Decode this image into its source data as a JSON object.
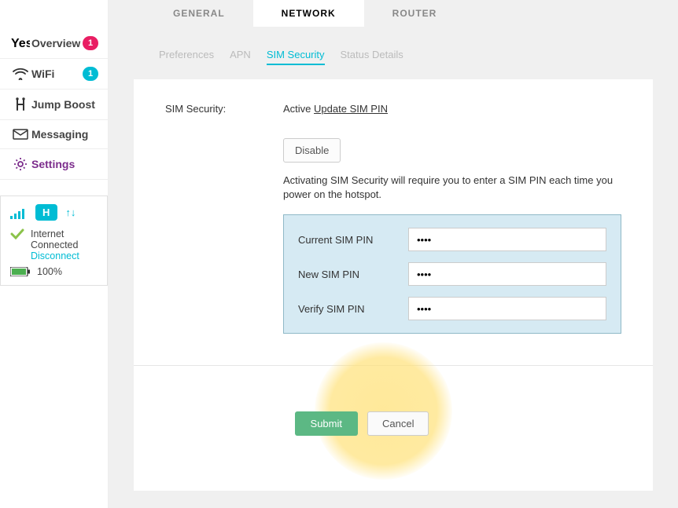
{
  "sidebar": {
    "items": [
      {
        "label": "Overview",
        "badge": "1",
        "badgeColor": "red"
      },
      {
        "label": "WiFi",
        "badge": "1",
        "badgeColor": "blue"
      },
      {
        "label": "Jump Boost"
      },
      {
        "label": "Messaging"
      },
      {
        "label": "Settings",
        "active": true
      }
    ]
  },
  "status": {
    "code": "H",
    "connected_label": "Internet Connected",
    "disconnect_label": "Disconnect",
    "battery_label": "100%"
  },
  "topTabs": {
    "general": "GENERAL",
    "network": "NETWORK",
    "router": "ROUTER"
  },
  "subTabs": {
    "preferences": "Preferences",
    "apn": "APN",
    "sim_security": "SIM Security",
    "status_details": "Status Details"
  },
  "sim": {
    "heading": "SIM Security:",
    "status": "Active",
    "update_link": "Update SIM PIN",
    "disable_label": "Disable",
    "help_text": "Activating SIM Security will require you to enter a SIM PIN each time you power on the hotspot.",
    "current_label": "Current SIM PIN",
    "new_label": "New SIM PIN",
    "verify_label": "Verify SIM PIN",
    "current_value": "••••",
    "new_value": "••••",
    "verify_value": "••••"
  },
  "buttons": {
    "submit": "Submit",
    "cancel": "Cancel"
  }
}
